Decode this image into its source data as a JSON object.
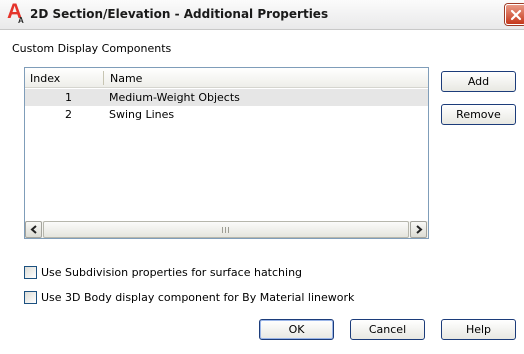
{
  "window": {
    "title": "2D Section/Elevation - Additional Properties"
  },
  "group_label": "Custom Display Components",
  "list": {
    "columns": {
      "index": "Index",
      "name": "Name"
    },
    "rows": [
      {
        "index": "1",
        "name": "Medium-Weight Objects",
        "selected": true
      },
      {
        "index": "2",
        "name": "Swing Lines",
        "selected": false
      }
    ]
  },
  "side_buttons": {
    "add": "Add",
    "remove": "Remove"
  },
  "options": {
    "subdivision": {
      "label": "Use Subdivision properties for surface hatching",
      "checked": false
    },
    "body_component": {
      "label": "Use 3D Body display component for By Material linework",
      "checked": false
    }
  },
  "footer": {
    "ok": "OK",
    "cancel": "Cancel",
    "help": "Help"
  },
  "icons": {
    "app": "autocad-app-icon",
    "close": "close-icon",
    "scroll_left": "arrow-left-icon",
    "scroll_right": "arrow-right-icon"
  }
}
